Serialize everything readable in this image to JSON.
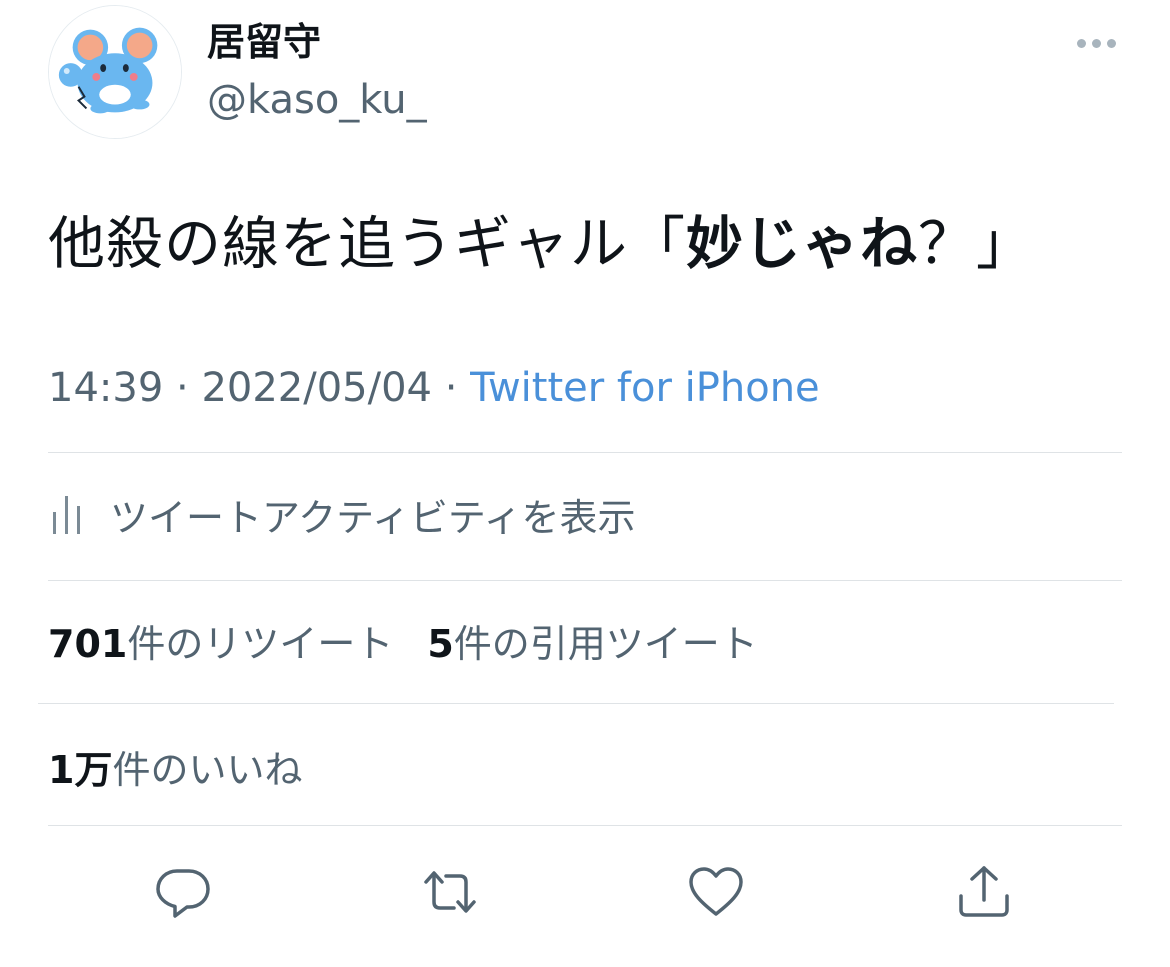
{
  "header": {
    "display_name": "居留守",
    "handle": "@kaso_ku_",
    "avatar_icon": "mouse-avatar-icon",
    "more_icon": "more-dots-icon"
  },
  "tweet": {
    "text_plain": "他殺の線を追うギャル「",
    "text_bold": "妙じゃね",
    "text_tail": "？」"
  },
  "meta": {
    "time": "14:39",
    "separator1": " · ",
    "date": "2022/05/04",
    "separator2": " · ",
    "source": "Twitter for iPhone"
  },
  "activity": {
    "icon": "analytics-bars-icon",
    "label": "ツイートアクティビティを表示"
  },
  "stats": {
    "retweets_count": "701",
    "retweets_label": "件のリツイート",
    "quotes_count": "5",
    "quotes_label": "件の引用ツイート",
    "likes_count": "1万",
    "likes_label": "件のいいね"
  },
  "actions": {
    "reply_icon": "reply-icon",
    "retweet_icon": "retweet-icon",
    "like_icon": "heart-icon",
    "share_icon": "share-icon"
  },
  "colors": {
    "text_primary": "#0f1419",
    "text_secondary": "#536471",
    "link": "#4a90d9",
    "divider": "#dfe3e6",
    "avatar_blue": "#6ab7f0",
    "avatar_ear": "#f4a889"
  }
}
